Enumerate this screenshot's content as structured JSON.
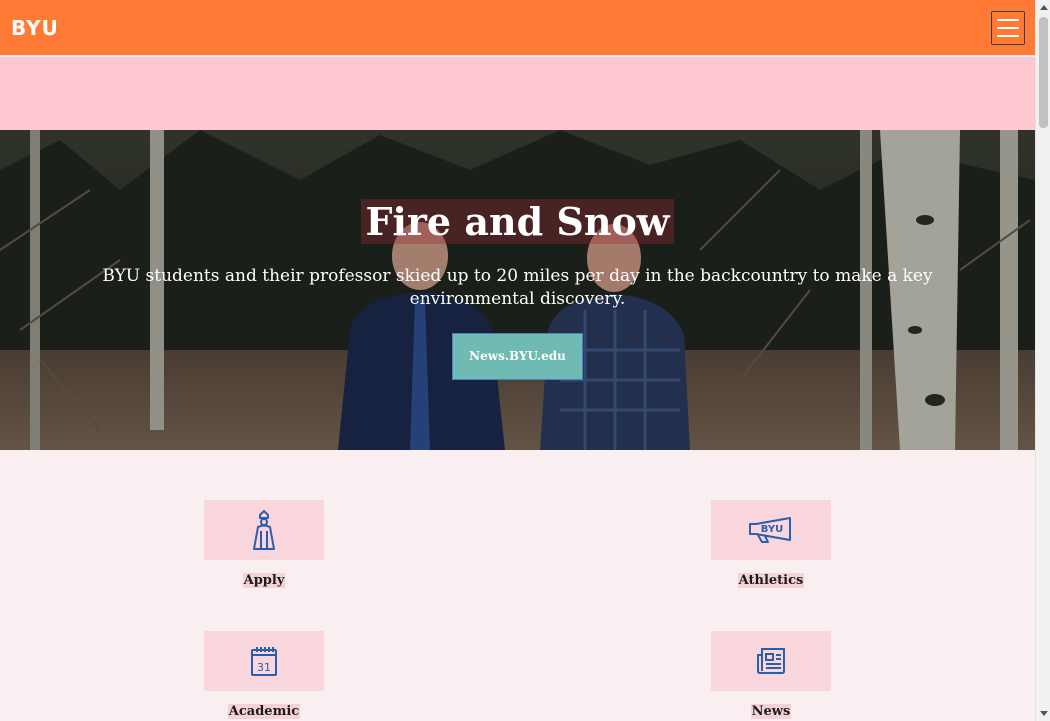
{
  "header": {
    "logo": "BYU",
    "menu_icon": "hamburger-icon",
    "background_color": "#ff7a35"
  },
  "alert_band": {
    "background_color": "#ffc8d0"
  },
  "hero": {
    "title": "Fire and Snow",
    "subtitle": "BYU students and their professor skied up to 20 miles per day in the backcountry to make a key environmental discovery.",
    "button_label": "News.BYU.edu",
    "button_color": "#6fbab3"
  },
  "tiles": [
    {
      "label": "Apply",
      "icon": "graduate-icon"
    },
    {
      "label": "Athletics",
      "icon": "megaphone-icon"
    },
    {
      "label": "Academic",
      "icon": "calendar-icon"
    },
    {
      "label": "News",
      "icon": "newspaper-icon"
    }
  ],
  "colors": {
    "accent_icon": "#2a5fb0",
    "tile_background": "#f8d6dc",
    "page_background": "#f9eef0"
  }
}
